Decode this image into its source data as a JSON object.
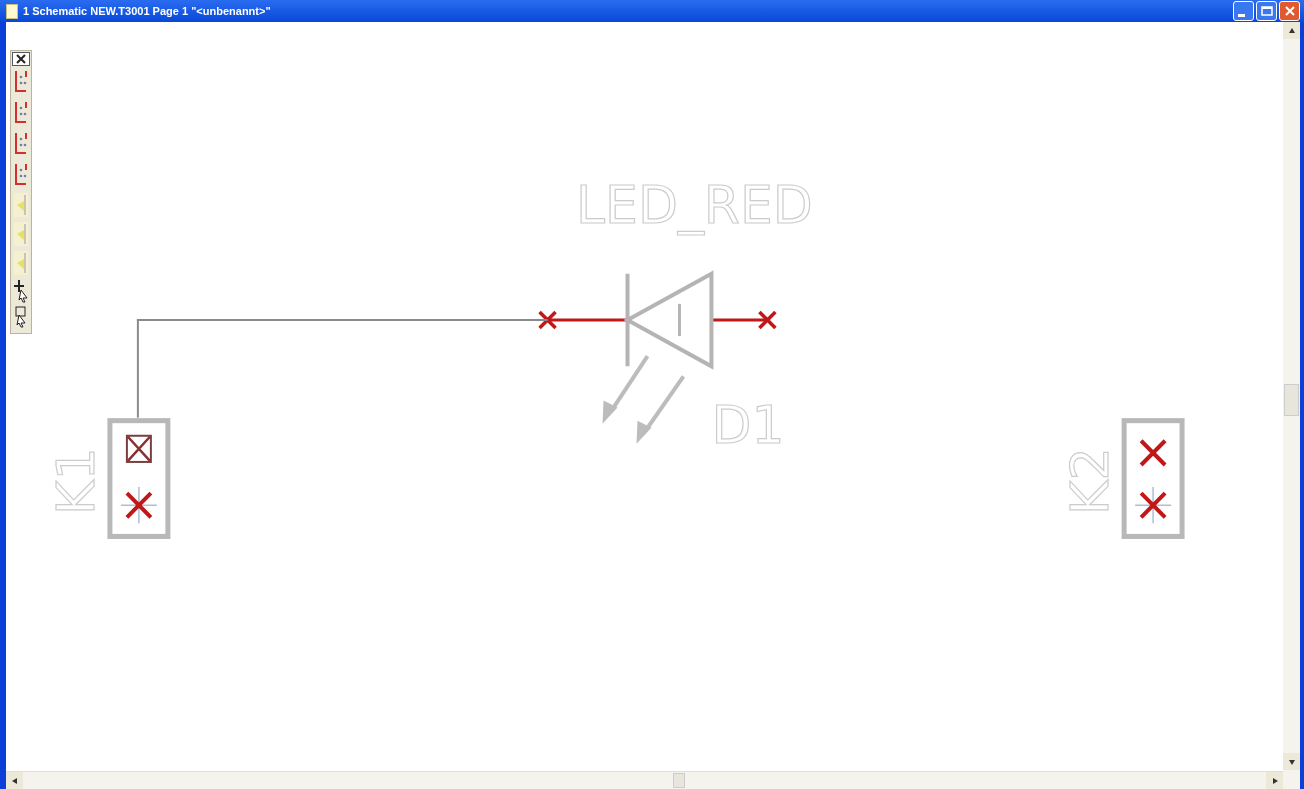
{
  "window": {
    "title": "1 Schematic NEW.T3001 Page 1 \"<unbenannt>\""
  },
  "schematic": {
    "components": [
      {
        "kind": "led",
        "value": "LED_RED",
        "ref": "D1"
      },
      {
        "kind": "connector",
        "ref": "K1",
        "wired": true
      },
      {
        "kind": "connector",
        "ref": "K2",
        "wired": false
      }
    ]
  }
}
